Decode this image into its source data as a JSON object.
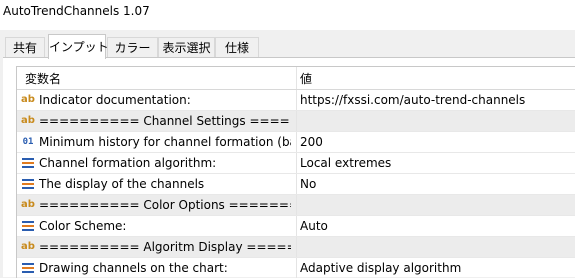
{
  "window": {
    "title": "AutoTrendChannels 1.07"
  },
  "tabs": [
    {
      "label": "共有",
      "active": false
    },
    {
      "label": "インプット",
      "active": true
    },
    {
      "label": "カラー",
      "active": false
    },
    {
      "label": "表示選択",
      "active": false
    },
    {
      "label": "仕様",
      "active": false
    }
  ],
  "table": {
    "headers": {
      "name": "変数名",
      "value": "値"
    },
    "rows": [
      {
        "icon": "ab-string-icon",
        "icon_text": "ab",
        "name": "Indicator documentation:",
        "value": "https://fxssi.com/auto-trend-channels",
        "group": false
      },
      {
        "icon": "ab-string-icon",
        "icon_text": "ab",
        "name": "========== Channel Settings ========...",
        "value": "",
        "group": true
      },
      {
        "icon": "integer-icon",
        "icon_text": "01",
        "name": "Minimum history for channel formation (bars):",
        "value": "200",
        "group": false
      },
      {
        "icon": "enum-list-icon",
        "icon_text": "",
        "name": "Channel formation algorithm:",
        "value": "Local extremes",
        "group": false
      },
      {
        "icon": "enum-list-icon",
        "icon_text": "",
        "name": "The display of the channels",
        "value": "No",
        "group": false
      },
      {
        "icon": "ab-string-icon",
        "icon_text": "ab",
        "name": "========== Color Options ==========",
        "value": "",
        "group": true
      },
      {
        "icon": "enum-list-icon",
        "icon_text": "",
        "name": "Color Scheme:",
        "value": "Auto",
        "group": false
      },
      {
        "icon": "ab-string-icon",
        "icon_text": "ab",
        "name": "========== Algoritm Display ========...",
        "value": "",
        "group": true
      },
      {
        "icon": "enum-list-icon",
        "icon_text": "",
        "name": "Drawing channels on the chart:",
        "value": "Adaptive display algorithm",
        "group": false
      }
    ]
  },
  "colors": {
    "ab_icon": "#c88a1c",
    "number_icon": "#2a5db0",
    "list_icon": "#2a5db0"
  }
}
